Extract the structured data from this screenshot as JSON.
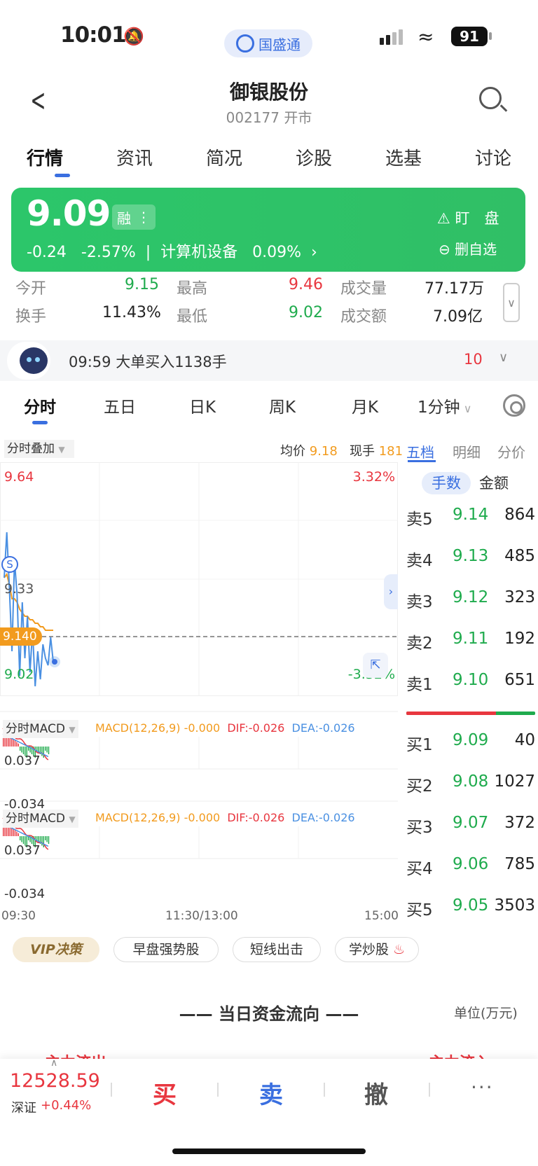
{
  "status_bar": {
    "time": "10:01",
    "pill_label": "国盛通",
    "battery": "91"
  },
  "header": {
    "title": "御银股份",
    "subtitle": "002177 开市"
  },
  "top_tabs": [
    "行情",
    "资讯",
    "简况",
    "诊股",
    "选基",
    "讨论"
  ],
  "quote": {
    "price": "9.09",
    "margin_tag": "融",
    "change": "-0.24",
    "change_pct": "-2.57%",
    "sector": "计算机设备",
    "sector_pct": "0.09%",
    "watch_label": "盯　盘",
    "remove_label": "删自选"
  },
  "stats": {
    "open_label": "今开",
    "open": "9.15",
    "high_label": "最高",
    "high": "9.46",
    "vol_label": "成交量",
    "vol": "77.17万",
    "turnover_label": "换手",
    "turnover": "11.43%",
    "low_label": "最低",
    "low": "9.02",
    "amount_label": "成交额",
    "amount": "7.09亿"
  },
  "notice": {
    "text": "09:59 大单买入1138手",
    "count": "10"
  },
  "chart_tabs": [
    "分时",
    "五日",
    "日K",
    "周K",
    "月K",
    "1分钟"
  ],
  "chart_header": {
    "overlay": "分时叠加",
    "avg_label": "均价",
    "avg": "9.18",
    "now_label": "现手",
    "now": "181"
  },
  "chart_data": {
    "type": "line",
    "price_axis": {
      "top": "9.64",
      "mid": "9.33",
      "bottom": "9.02",
      "top_pct": "3.32%",
      "bottom_pct": "-3.32%",
      "current": "9.140"
    },
    "signal": "S",
    "time_labels": [
      "09:30",
      "11:30/13:00",
      "15:00"
    ],
    "macd_panels": [
      {
        "label": "分时MACD",
        "macd": "MACD(12,26,9) -0.000",
        "dif": "DIF:-0.026",
        "dea": "DEA:-0.026",
        "top": "0.037",
        "bottom": "-0.034"
      },
      {
        "label": "分时MACD",
        "macd": "MACD(12,26,9) -0.000",
        "dif": "DIF:-0.026",
        "dea": "DEA:-0.026",
        "top": "0.037",
        "bottom": "-0.034"
      }
    ],
    "price_series": [
      9.33,
      9.46,
      9.3,
      9.12,
      9.38,
      9.28,
      9.05,
      9.26,
      9.1,
      9.22,
      9.06,
      9.18,
      9.02,
      9.12,
      9.04,
      9.14,
      9.1,
      9.08,
      9.16,
      9.09
    ],
    "avg_series": [
      9.33,
      9.34,
      9.31,
      9.27,
      9.27,
      9.26,
      9.24,
      9.23,
      9.22,
      9.22,
      9.21,
      9.21,
      9.2,
      9.2,
      9.19,
      9.19,
      9.18,
      9.18,
      9.18,
      9.18
    ],
    "colors": {
      "price": "#4a90e2",
      "avg": "#f29b1e",
      "up": "#e8363f",
      "down": "#1fab4d"
    }
  },
  "orderbook": {
    "tabs": [
      "五档",
      "明细",
      "分价"
    ],
    "unit_tabs": [
      "手数",
      "金额"
    ],
    "asks": [
      {
        "name": "卖5",
        "price": "9.14",
        "vol": "864"
      },
      {
        "name": "卖4",
        "price": "9.13",
        "vol": "485"
      },
      {
        "name": "卖3",
        "price": "9.12",
        "vol": "323"
      },
      {
        "name": "卖2",
        "price": "9.11",
        "vol": "192"
      },
      {
        "name": "卖1",
        "price": "9.10",
        "vol": "651"
      }
    ],
    "bids": [
      {
        "name": "买1",
        "price": "9.09",
        "vol": "40"
      },
      {
        "name": "买2",
        "price": "9.08",
        "vol": "1027"
      },
      {
        "name": "买3",
        "price": "9.07",
        "vol": "372"
      },
      {
        "name": "买4",
        "price": "9.06",
        "vol": "785"
      },
      {
        "name": "买5",
        "price": "9.05",
        "vol": "3503"
      }
    ]
  },
  "chips": [
    "VIP决策",
    "早盘强势股",
    "短线出击",
    "学炒股"
  ],
  "fund_flow": {
    "title": "—— 当日资金流向 ——",
    "unit": "单位(万元)",
    "left": "主力流出",
    "right": "主力流入"
  },
  "bottom_bar": {
    "index_value": "12528.59",
    "index_name": "深证",
    "index_change": "+0.44%",
    "buy": "买",
    "sell": "卖",
    "cancel": "撤",
    "more": "···"
  }
}
